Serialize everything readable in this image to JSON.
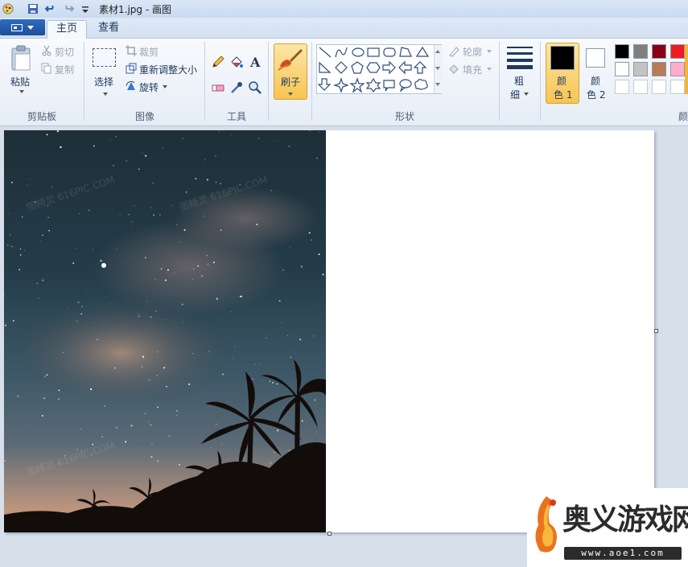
{
  "window": {
    "title": "素材1.jpg - 画图"
  },
  "tabs": [
    {
      "label": "主页",
      "active": true
    },
    {
      "label": "查看",
      "active": false
    }
  ],
  "clipboard": {
    "paste": "粘贴",
    "cut": "剪切",
    "copy": "复制",
    "group_label": "剪贴板"
  },
  "image": {
    "select": "选择",
    "crop": "裁剪",
    "resize": "重新调整大小",
    "rotate": "旋转",
    "group_label": "图像"
  },
  "tools": {
    "group_label": "工具",
    "items": [
      "pencil-icon",
      "fill-icon",
      "text-icon",
      "eraser-icon",
      "color-picker-icon",
      "magnifier-icon"
    ]
  },
  "brushes": {
    "label": "刷子"
  },
  "shapes": {
    "outline": "轮廓",
    "fill": "填充",
    "group_label": "形状"
  },
  "size": {
    "label_line1": "粗",
    "label_line2": "细"
  },
  "colors": {
    "color1_line1": "颜",
    "color1_line2": "色 1",
    "color2_line1": "颜",
    "color2_line2": "色 2",
    "group_label": "颜",
    "color1_value": "#000000",
    "color2_value": "#ffffff",
    "palette": [
      "#000000",
      "#7f7f7f",
      "#880015",
      "#ed1c24",
      "#ffffff",
      "#c3c3c3",
      "#b97a57",
      "#ffaec9",
      "#ffffff",
      "#ffffff",
      "#ffffff",
      "#ffffff"
    ]
  },
  "watermarks": {
    "photo_text": "图精灵 616PIC.COM",
    "site_name": "奥义游戏网",
    "site_url": "www.aoe1.com"
  }
}
